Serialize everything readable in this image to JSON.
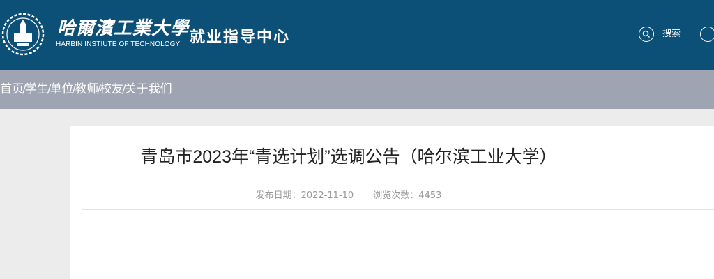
{
  "header": {
    "university_cn": "哈爾濱工業大學",
    "university_en": "HARBIN INSTIUTE OF TECHNOLOGY",
    "site_title": "就业指导中心",
    "search_label": "搜索",
    "bg_color": "#0d5077",
    "icons": {
      "emblem": "university-emblem",
      "search": "search-icon",
      "user": "user-icon"
    }
  },
  "nav": {
    "items": [
      "首页",
      "学生",
      "单位",
      "教师",
      "校友",
      "关于我们"
    ],
    "separator": "/",
    "bg_color": "#9ea4b1"
  },
  "article": {
    "title": "青岛市2023年“青选计划”选调公告（哈尔滨工业大学）",
    "publish_label": "发布日期：2022-11-10",
    "views_label": "浏览次数：4453"
  }
}
